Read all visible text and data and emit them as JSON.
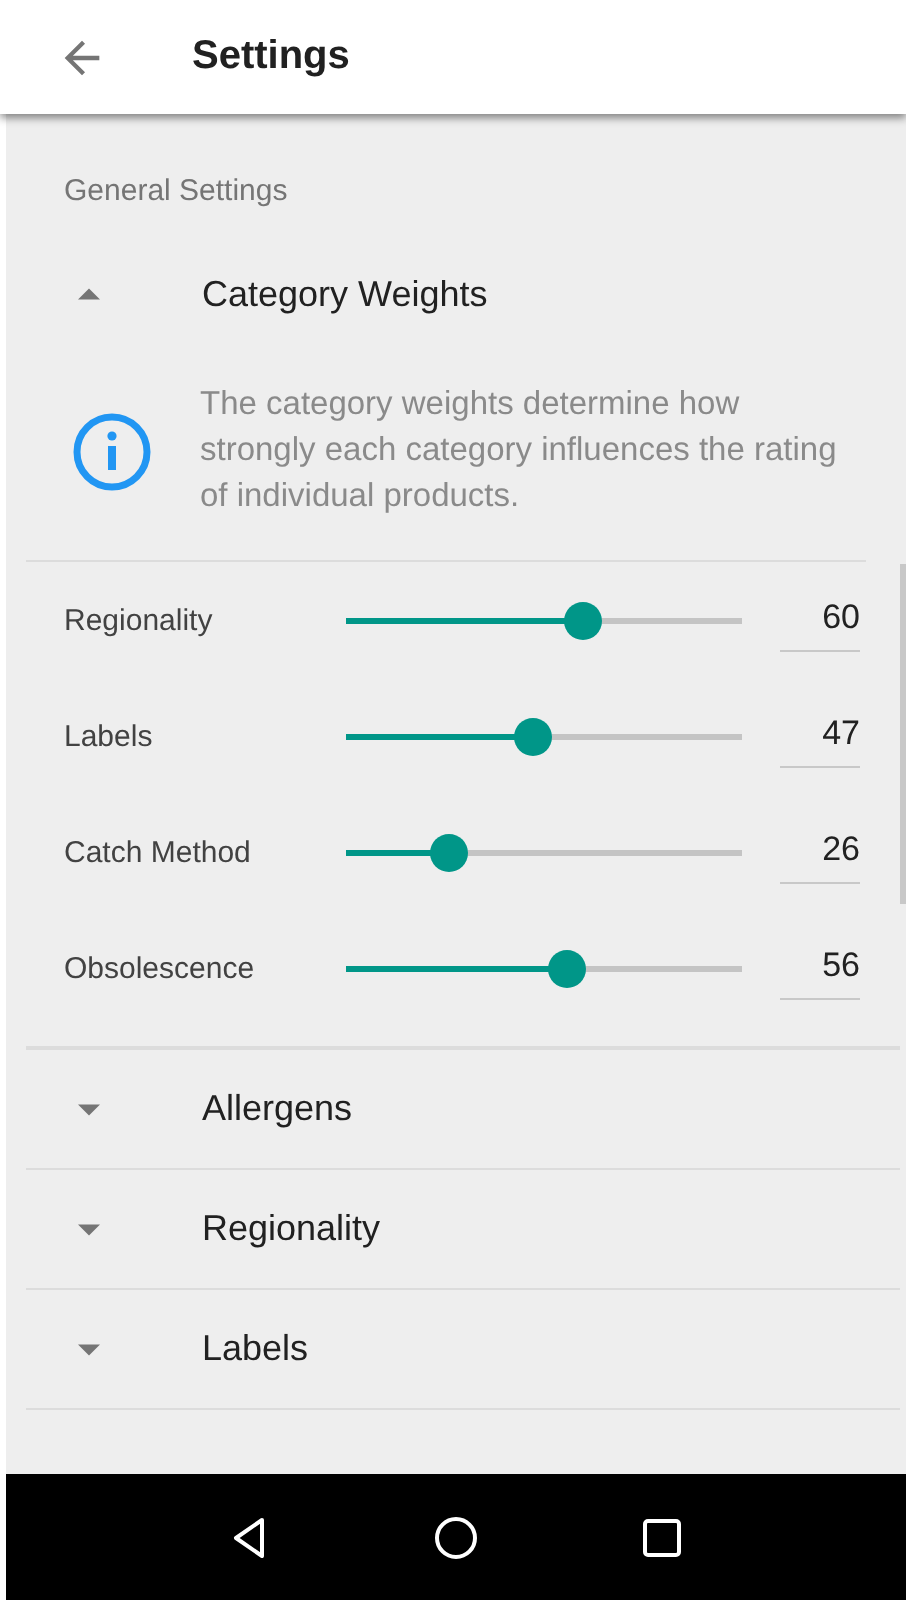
{
  "app_bar": {
    "title": "Settings"
  },
  "section_header": "General Settings",
  "sections": [
    {
      "title": "Category Weights",
      "expanded": true,
      "info": "The category weights determine how strongly each category influences the rating of individual products.",
      "sliders": [
        {
          "label": "Regionality",
          "level": 0.6,
          "value": "60"
        },
        {
          "label": "Labels",
          "level": 0.47,
          "value": "47"
        },
        {
          "label": "Catch Method",
          "level": 0.26,
          "value": "26"
        },
        {
          "label": "Obsolescence",
          "level": 0.56,
          "value": "56"
        }
      ]
    },
    {
      "title": "Allergens",
      "expanded": false
    },
    {
      "title": "Regionality",
      "expanded": false
    },
    {
      "title": "Labels",
      "expanded": false
    }
  ]
}
